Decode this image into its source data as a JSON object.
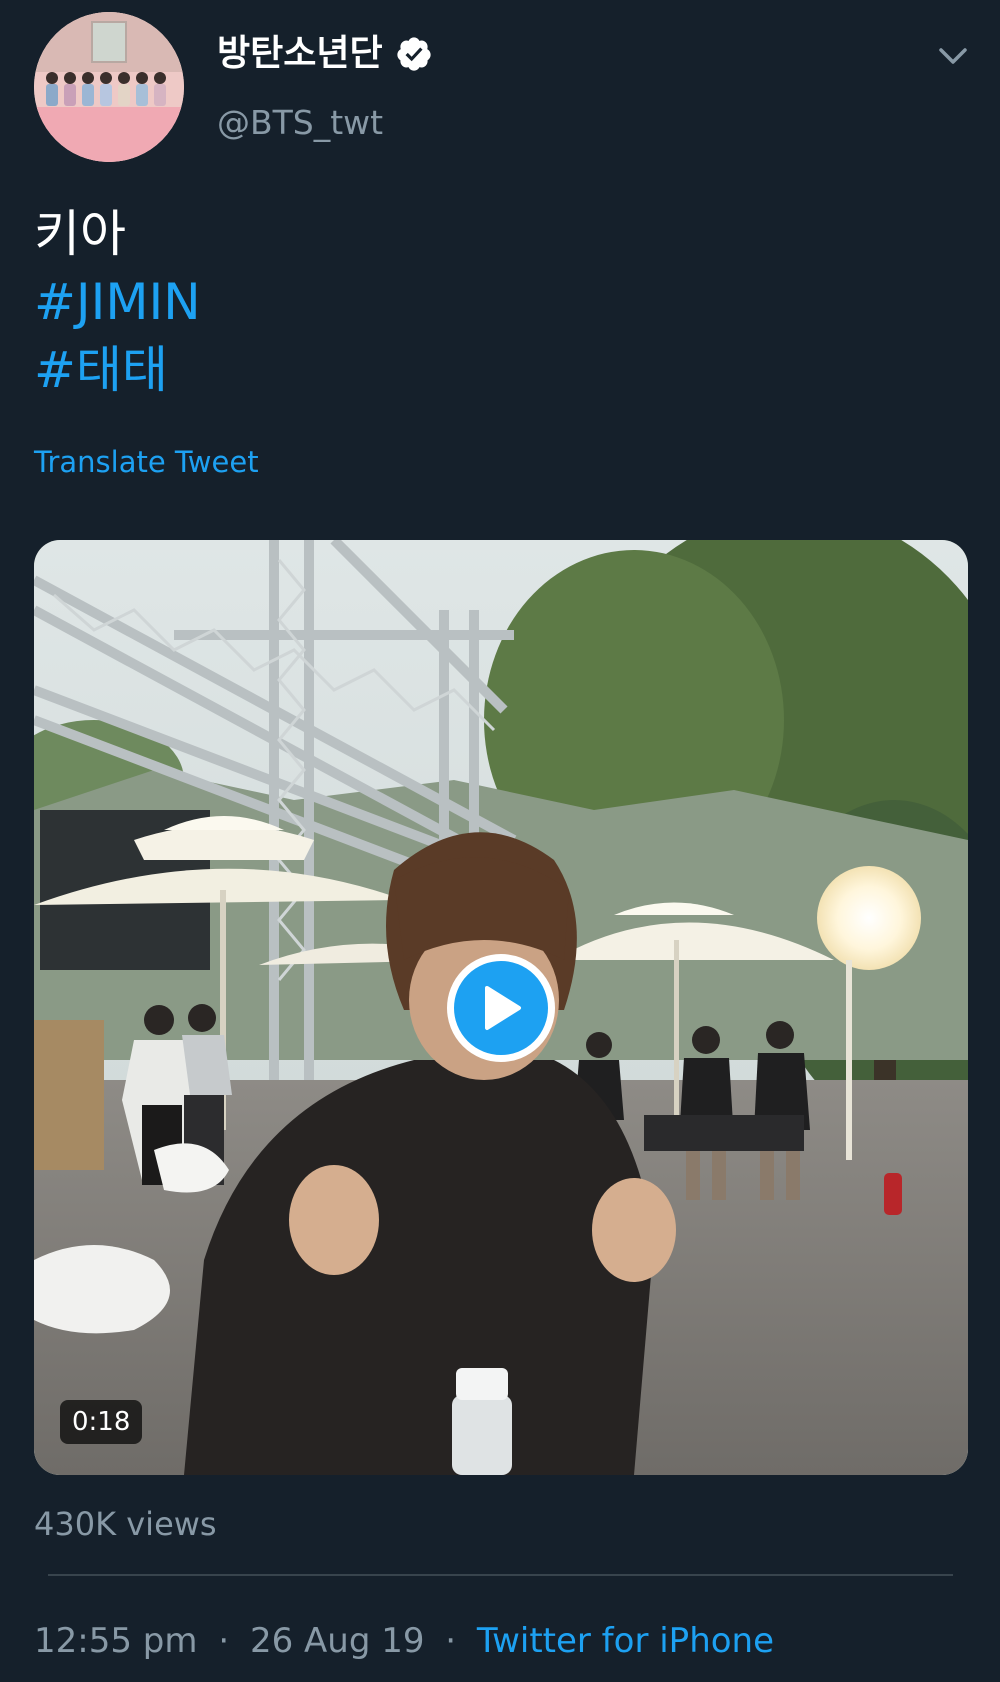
{
  "tweet": {
    "author": {
      "display_name": "방탄소년단",
      "handle": "@BTS_twt",
      "verified_icon": "verified-badge-icon"
    },
    "menu_icon": "chevron-down-icon",
    "text_lines": [
      "키아"
    ],
    "hashtags": [
      "#JIMIN",
      "#태태"
    ],
    "translate_label": "Translate Tweet",
    "media": {
      "type": "video",
      "duration": "0:18",
      "play_icon": "play-icon"
    },
    "views": "430K views",
    "time": "12:55 pm",
    "date": "26 Aug 19",
    "separator": "·",
    "source": "Twitter for iPhone"
  },
  "colors": {
    "background": "#15202b",
    "accent": "#1da1f2",
    "secondary_text": "#8899a6",
    "divider": "#38444d"
  }
}
